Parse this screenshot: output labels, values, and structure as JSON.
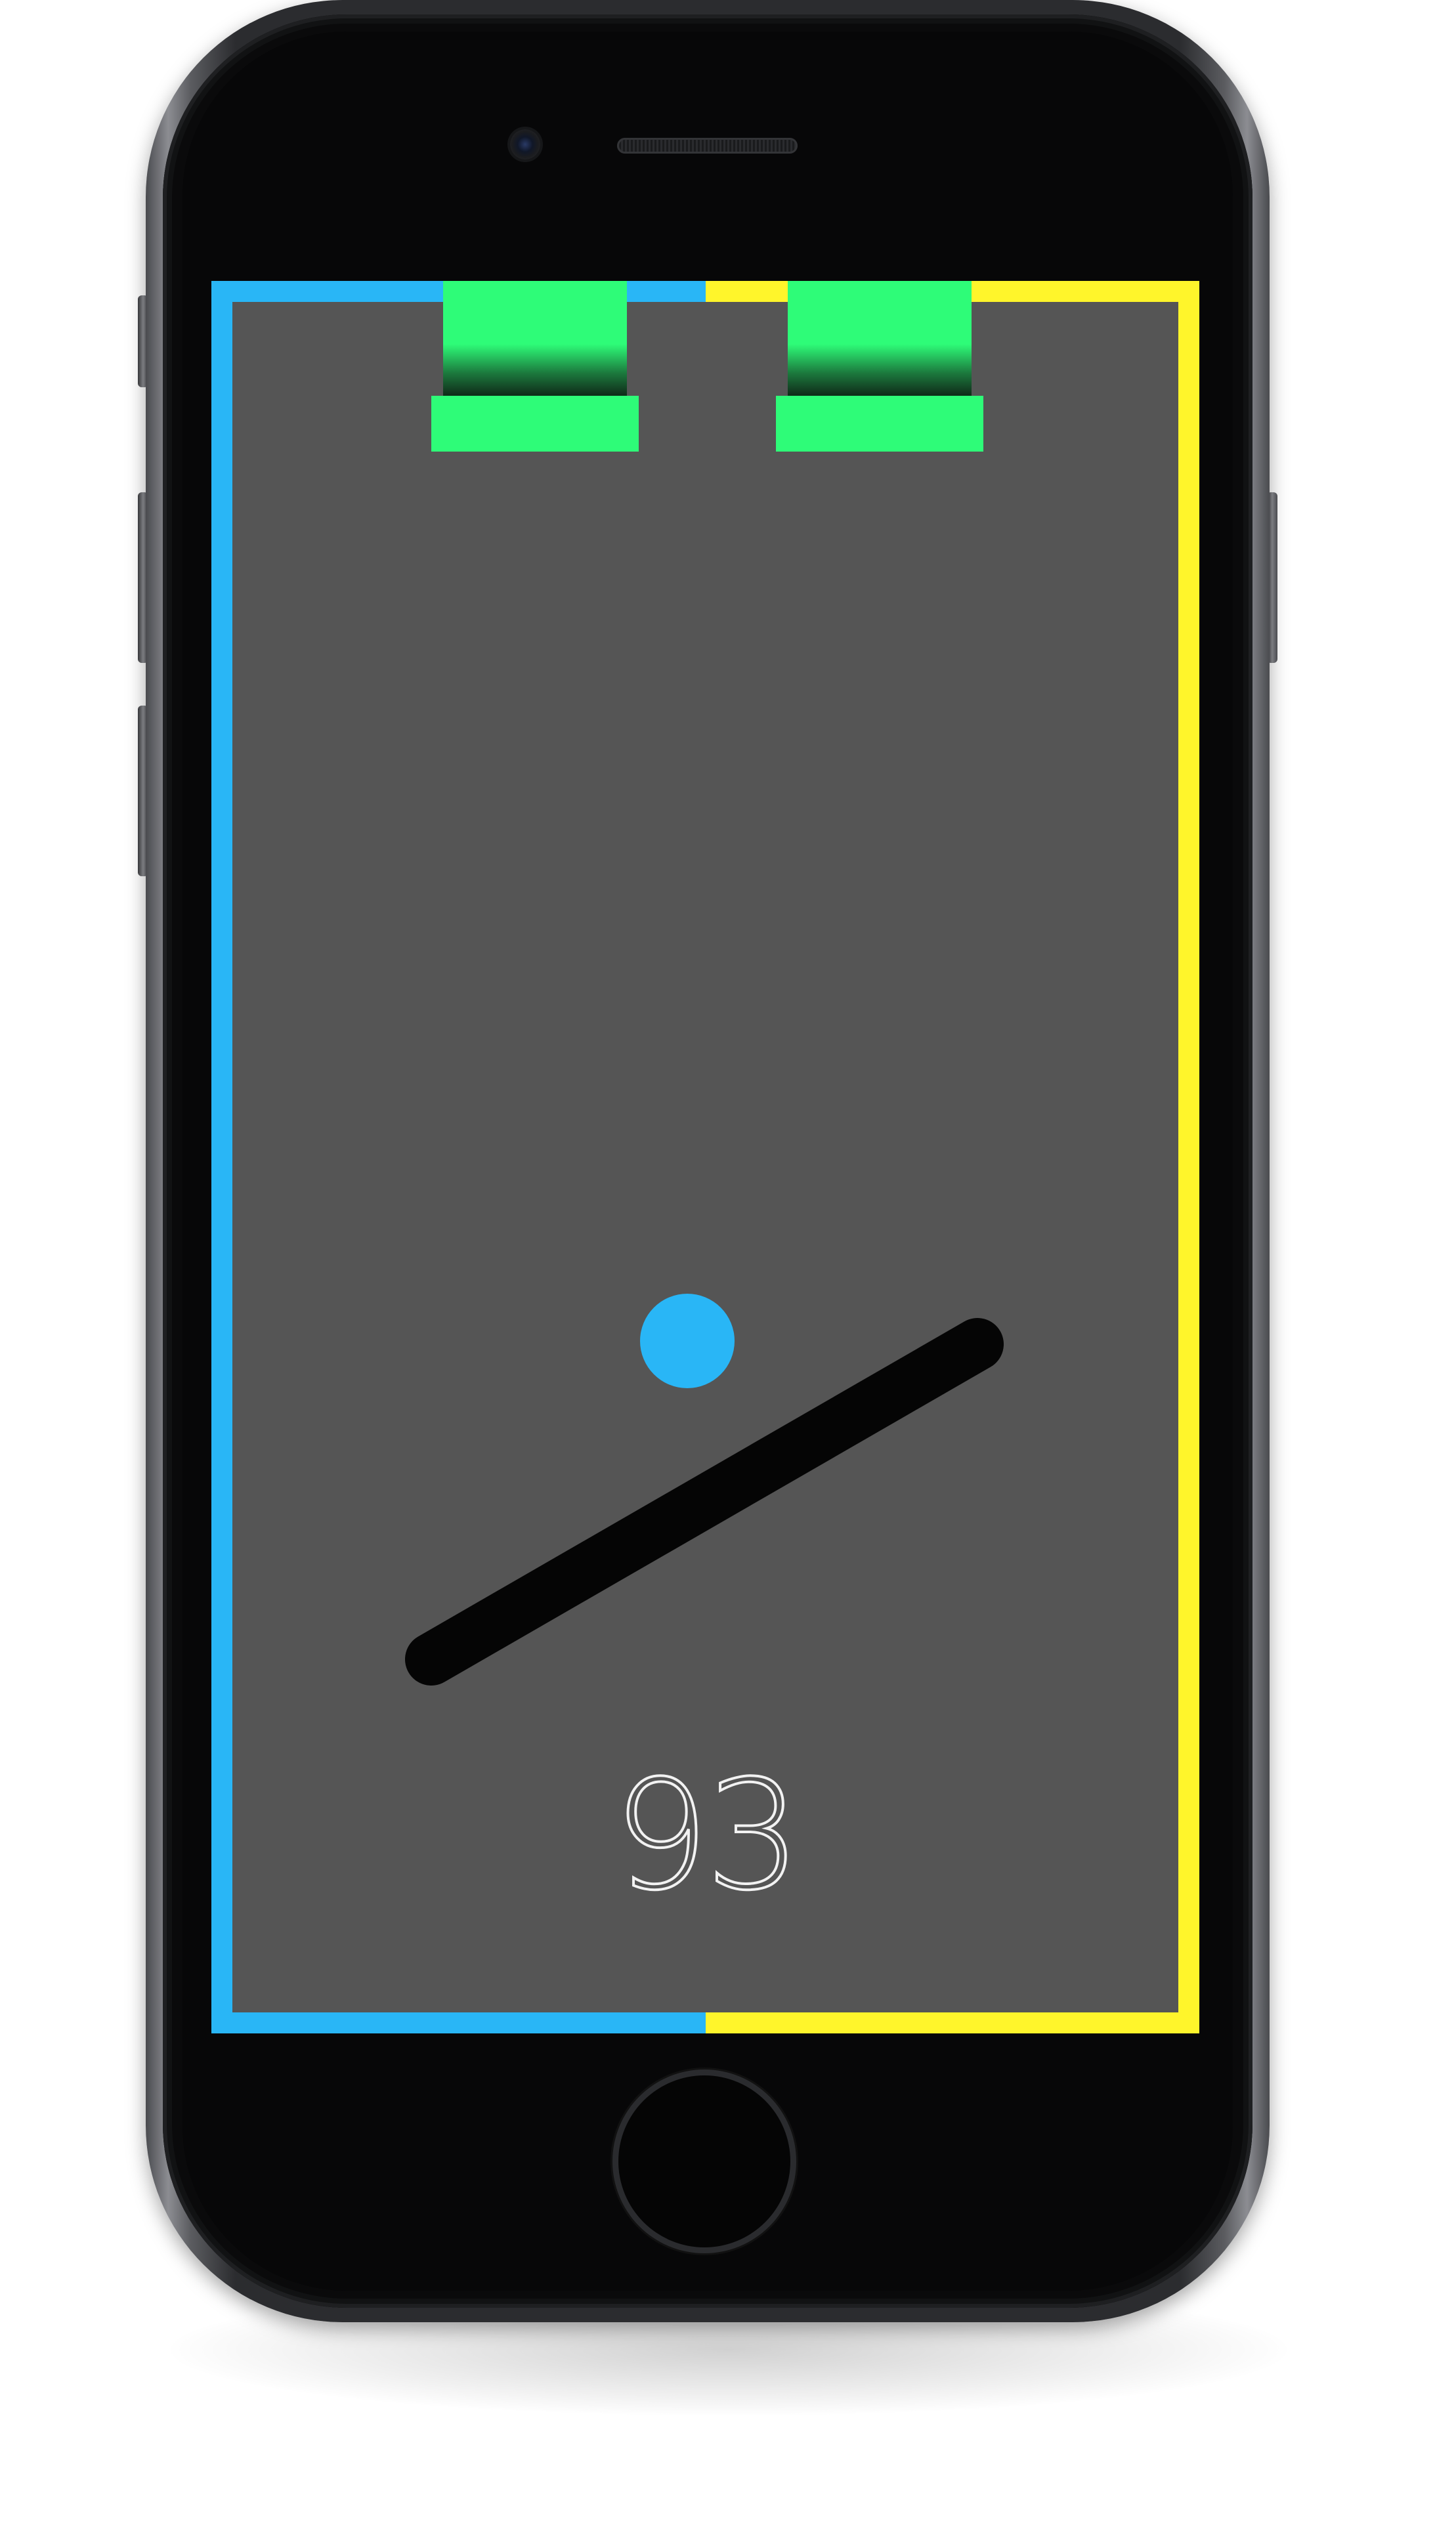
{
  "game": {
    "score": "93",
    "colors": {
      "background": "#555555",
      "left_wall": "#29B6F6",
      "right_wall": "#FFF52B",
      "ball": "#29B6F6",
      "paddle": "#050505",
      "goal": "#2EFC78",
      "score_text": "#F2F2F2"
    },
    "goals_count": 2
  },
  "device": {
    "type": "phone",
    "icons": [
      "camera-icon",
      "speaker-grille",
      "home-button"
    ]
  }
}
